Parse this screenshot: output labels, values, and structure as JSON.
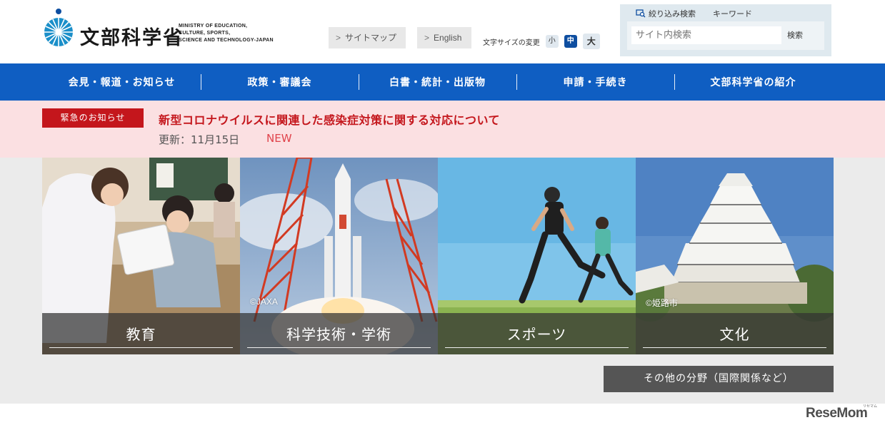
{
  "header": {
    "logo_jp": "文部科学省",
    "logo_en": [
      "MINISTRY OF EDUCATION,",
      "CULTURE, SPORTS,",
      "SCIENCE AND TECHNOLOGY-JAPAN"
    ],
    "sitemap_label": "サイトマップ",
    "english_label": "English",
    "fontsize_label": "文字サイズの変更",
    "fontsize_small": "小",
    "fontsize_medium": "中",
    "fontsize_large": "大",
    "search": {
      "filter_tab": "絞り込み検索",
      "keyword_tab": "キーワード",
      "placeholder": "サイト内検索",
      "button": "検索"
    }
  },
  "nav": {
    "items": [
      {
        "label": "会見・報道・お知らせ"
      },
      {
        "label": "政策・審議会"
      },
      {
        "label": "白書・統計・出版物"
      },
      {
        "label": "申請・手続き"
      },
      {
        "label": "文部科学省の紹介"
      }
    ]
  },
  "alert": {
    "badge": "緊急のお知らせ",
    "title": "新型コロナウイルスに関連した感染症対策に関する対応について",
    "updated": "更新：11月15日",
    "new_label": "NEW"
  },
  "tiles": [
    {
      "label": "教育",
      "credit": ""
    },
    {
      "label": "科学技術・学術",
      "credit": "©JAXA"
    },
    {
      "label": "スポーツ",
      "credit": ""
    },
    {
      "label": "文化",
      "credit": "©姫路市"
    }
  ],
  "other_fields": "その他の分野（国際関係など）",
  "watermark": "ReseMom",
  "watermark_small": "リセマム",
  "colors": {
    "nav_blue": "#0f5ec2",
    "alert_red": "#c4161c",
    "alert_bg": "#fbe0e2",
    "active_fontsize": "#0e4ea0"
  }
}
